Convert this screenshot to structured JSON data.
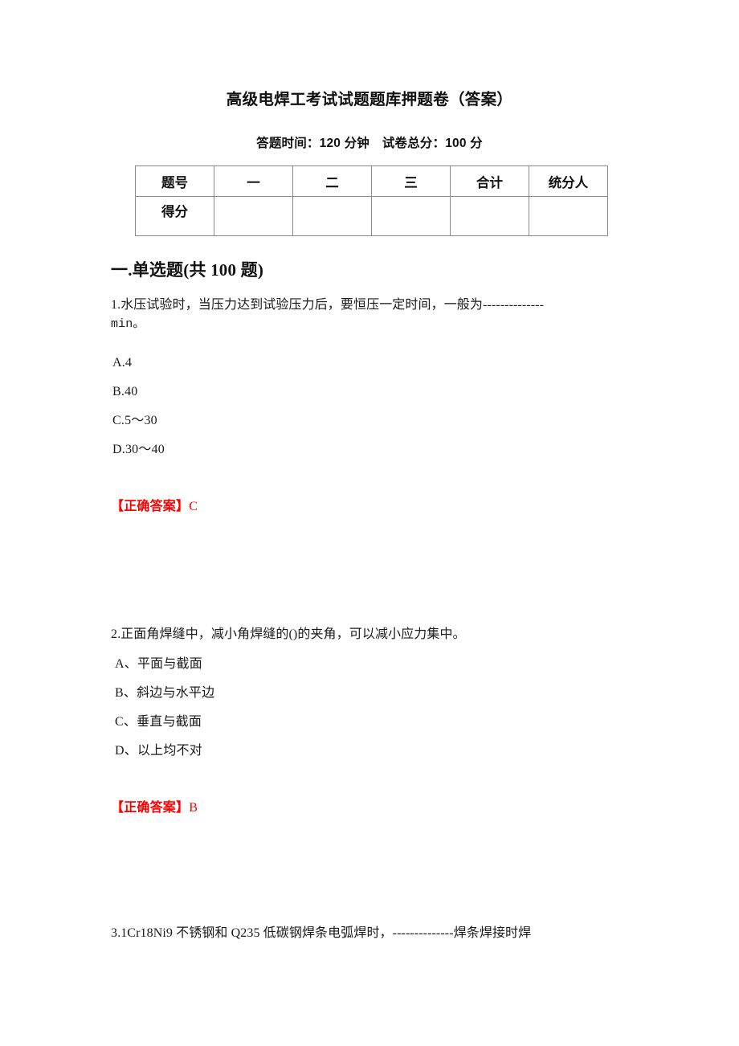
{
  "document": {
    "title": "高级电焊工考试试题题库押题卷（答案）",
    "subtitle": "答题时间：120 分钟　试卷总分：100 分"
  },
  "score_table": {
    "header": [
      "题号",
      "一",
      "二",
      "三",
      "合计",
      "统分人"
    ],
    "rows": [
      {
        "label": "得分",
        "cells": [
          "",
          "",
          "",
          "",
          ""
        ]
      }
    ]
  },
  "sections": [
    {
      "heading": "一.单选题(共 100 题)"
    }
  ],
  "questions": [
    {
      "number": "1",
      "stem_line_1": "1.水压试验时，当压力达到试验压力后，要恒压一定时间，一般为--------------",
      "stem_line_2": "min。",
      "options": [
        {
          "key": "A",
          "text": "A.4"
        },
        {
          "key": "B",
          "text": "B.40"
        },
        {
          "key": "C",
          "text": "C.5～30"
        },
        {
          "key": "D",
          "text": "D.30～40"
        }
      ],
      "answer_label": "【正确答案】",
      "answer_value": "C"
    },
    {
      "number": "2",
      "stem_line_1": "2.正面角焊缝中，减小角焊缝的()的夹角，可以减小应力集中。",
      "options": [
        {
          "key": "A",
          "text": "A、平面与截面"
        },
        {
          "key": "B",
          "text": "B、斜边与水平边"
        },
        {
          "key": "C",
          "text": "C、垂直与截面"
        },
        {
          "key": "D",
          "text": "D、以上均不对"
        }
      ],
      "answer_label": "【正确答案】",
      "answer_value": "B"
    },
    {
      "number": "3",
      "stem_line_1": "3.1Cr18Ni9 不锈钢和 Q235 低碳钢焊条电弧焊时，--------------焊条焊接时焊"
    }
  ],
  "colors": {
    "answer_red": "#ff0000",
    "text_black": "#1a1a1a",
    "table_border": "#8a8a8a",
    "page_background": "#ffffff"
  }
}
